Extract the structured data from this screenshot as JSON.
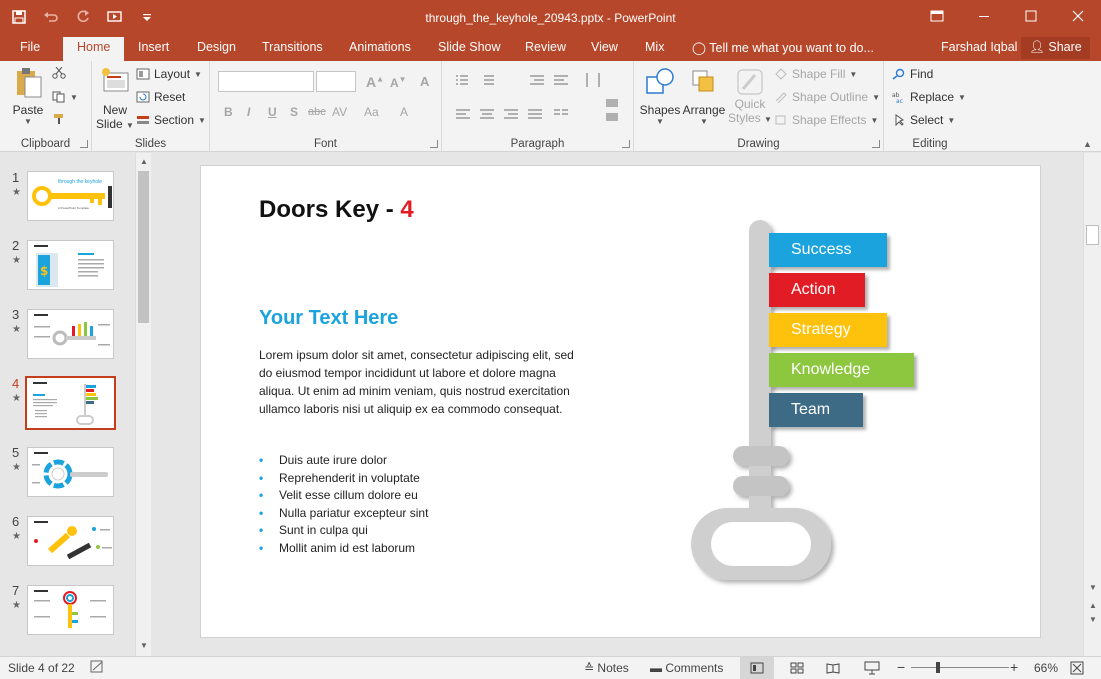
{
  "window": {
    "title": "through_the_keyhole_20943.pptx - PowerPoint"
  },
  "tabs": [
    "File",
    "Home",
    "Insert",
    "Design",
    "Transitions",
    "Animations",
    "Slide Show",
    "Review",
    "View",
    "Mix"
  ],
  "active_tab": "Home",
  "tell_me": "Tell me what you want to do...",
  "user": "Farshad Iqbal",
  "share_label": "Share",
  "ribbon": {
    "clipboard": {
      "label": "Clipboard",
      "paste": "Paste"
    },
    "slides": {
      "label": "Slides",
      "new_slide_line1": "New",
      "new_slide_line2": "Slide",
      "layout": "Layout",
      "reset": "Reset",
      "section": "Section"
    },
    "font": {
      "label": "Font",
      "bold": "B",
      "italic": "I",
      "underline": "U",
      "shadow": "S",
      "strike": "abc",
      "spacing": "AV",
      "case": "Aa"
    },
    "paragraph": {
      "label": "Paragraph"
    },
    "drawing": {
      "label": "Drawing",
      "shapes": "Shapes",
      "arrange": "Arrange",
      "quick_styles_line1": "Quick",
      "quick_styles_line2": "Styles",
      "shape_fill": "Shape Fill",
      "shape_outline": "Shape Outline",
      "shape_effects": "Shape Effects"
    },
    "editing": {
      "label": "Editing",
      "find": "Find",
      "replace": "Replace",
      "select": "Select"
    }
  },
  "thumbnails": [
    {
      "num": "1",
      "star": "★"
    },
    {
      "num": "2",
      "star": "★"
    },
    {
      "num": "3",
      "star": "★"
    },
    {
      "num": "4",
      "star": "★"
    },
    {
      "num": "5",
      "star": "★"
    },
    {
      "num": "6",
      "star": "★"
    },
    {
      "num": "7",
      "star": "★"
    }
  ],
  "active_slide": "4",
  "thumb1_text": {
    "line1": "through the keyhole",
    "line2": "A PowerPoint Template"
  },
  "slide": {
    "title": "Doors Key - ",
    "title_number": "4",
    "subtitle": "Your Text Here",
    "body": "Lorem ipsum dolor sit amet, consectetur adipiscing elit, sed do eiusmod tempor incididunt ut labore et dolore magna aliqua. Ut enim ad minim veniam, quis nostrud exercitation ullamco laboris nisi ut aliquip ex ea commodo consequat.",
    "bullets": [
      "Duis aute irure dolor",
      "Reprehenderit in voluptate",
      "Velit esse cillum dolore eu",
      "Nulla pariatur excepteur sint",
      "Sunt in culpa qui",
      "Mollit anim id est laborum"
    ],
    "tags": [
      {
        "label": "Success",
        "color": "#1aa3dd"
      },
      {
        "label": "Action",
        "color": "#e21c24"
      },
      {
        "label": "Strategy",
        "color": "#fec20d"
      },
      {
        "label": "Knowledge",
        "color": "#8dc63f"
      },
      {
        "label": "Team",
        "color": "#3d6a85"
      }
    ]
  },
  "status": {
    "slide_of": "Slide 4 of 22",
    "notes": "Notes",
    "comments": "Comments",
    "zoom": "66%"
  },
  "colors": {
    "accent": "#b7472a",
    "key_gray": "#cfcfcf"
  }
}
